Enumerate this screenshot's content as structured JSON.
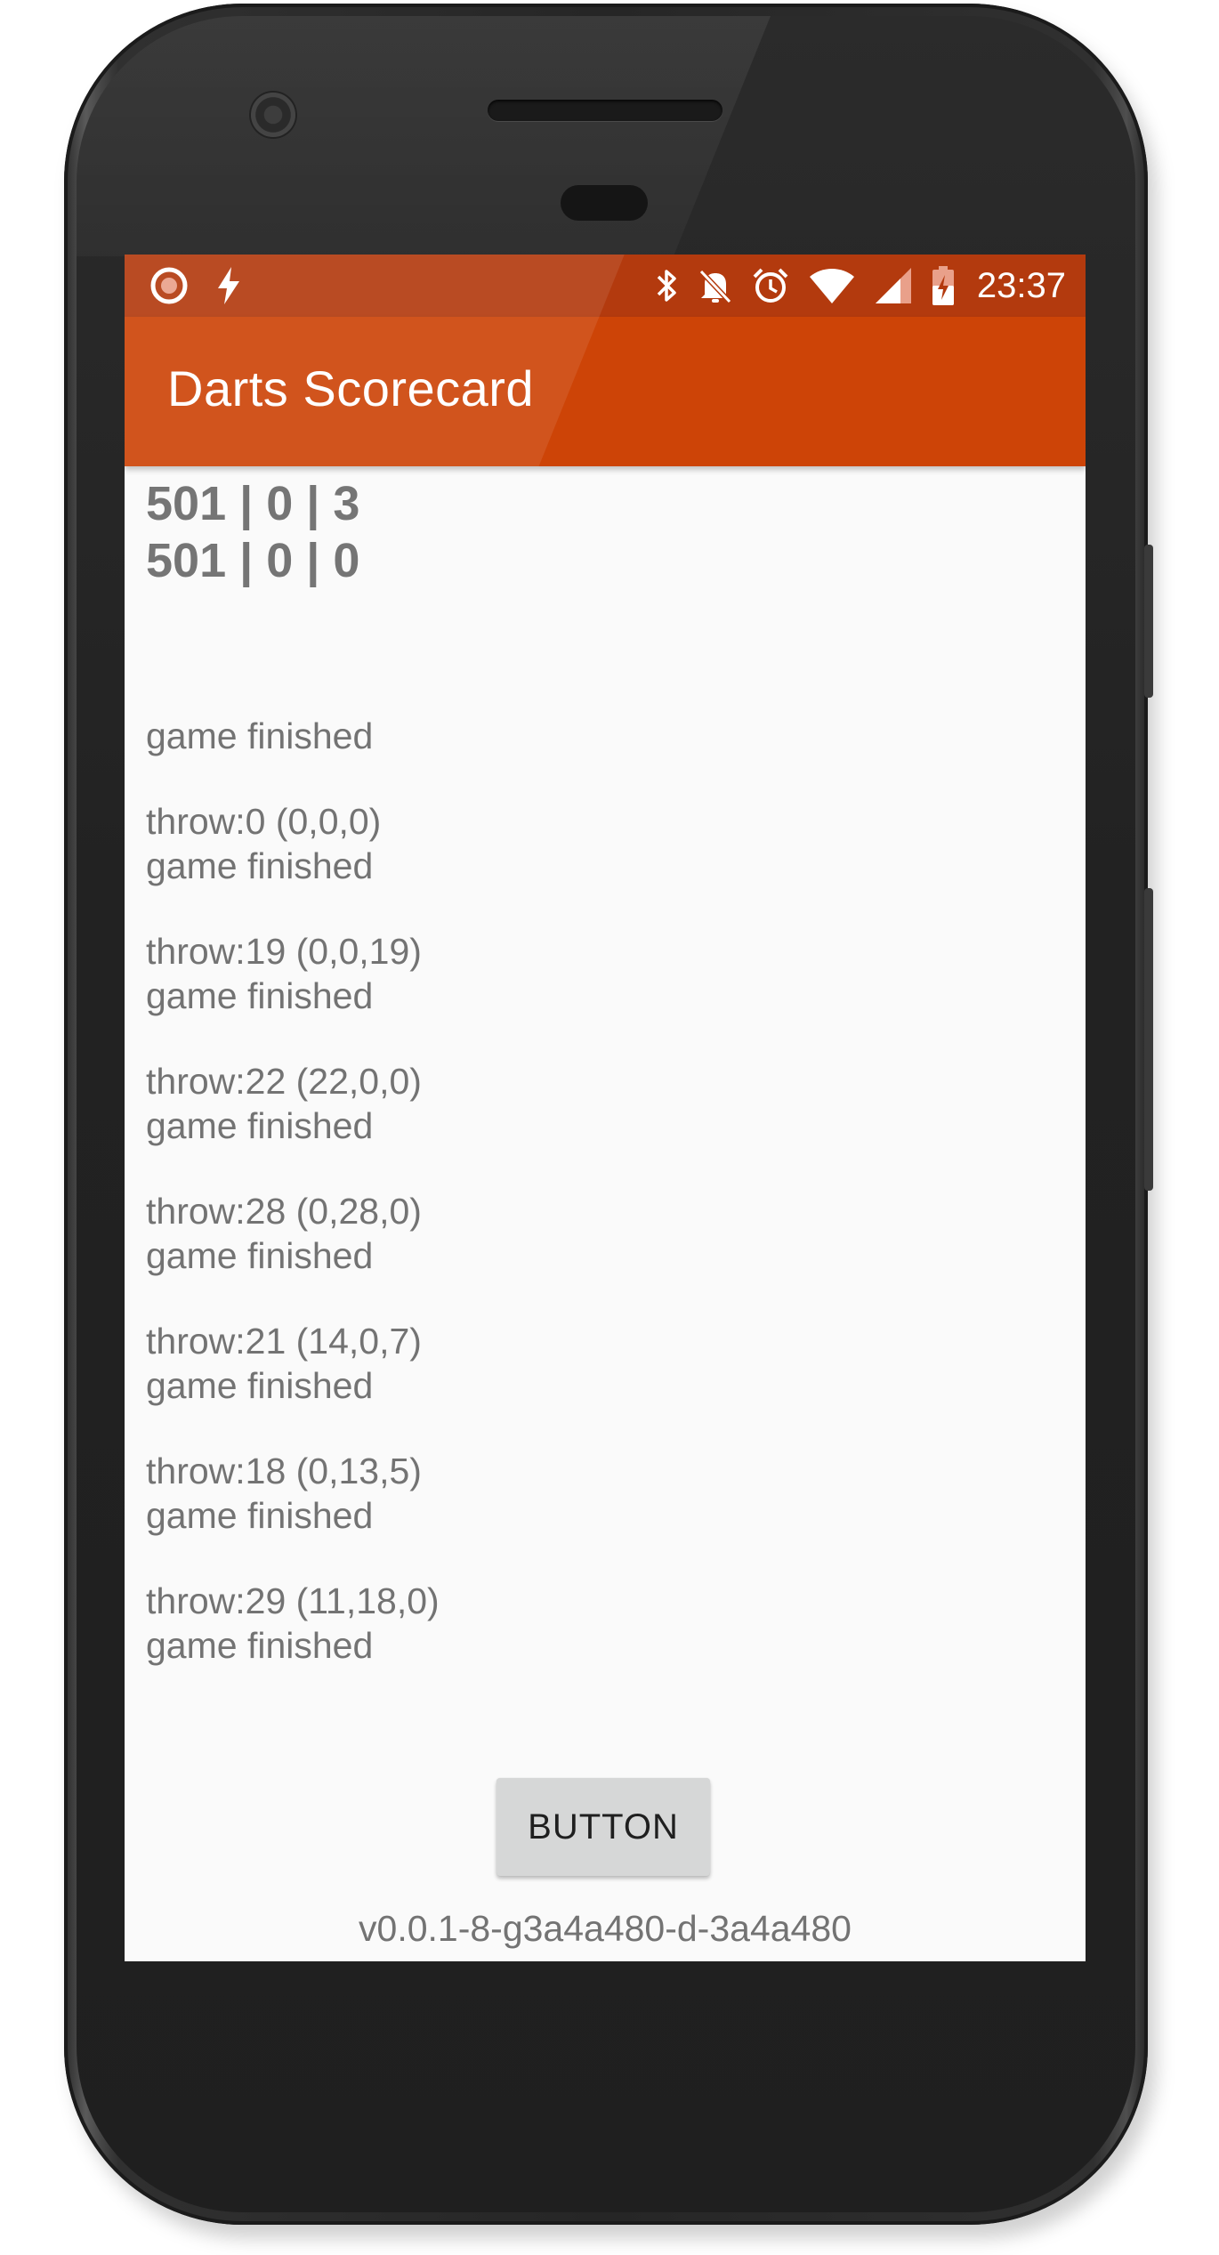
{
  "status_bar": {
    "time": "23:37",
    "left_icons": [
      "record-icon",
      "flash-icon"
    ],
    "right_icons": [
      "bluetooth-icon",
      "notifications-off-icon",
      "alarm-icon",
      "wifi-icon",
      "cell-signal-icon",
      "battery-charging-icon"
    ]
  },
  "app_bar": {
    "title": "Darts Scorecard"
  },
  "scores": [
    {
      "line": "501 | 0 | 3"
    },
    {
      "line": "501 | 0 | 0"
    }
  ],
  "log": [
    {
      "throw": "",
      "status": "game finished"
    },
    {
      "throw": "throw:0 (0,0,0)",
      "status": "game finished"
    },
    {
      "throw": "throw:19 (0,0,19)",
      "status": "game finished"
    },
    {
      "throw": "throw:22 (22,0,0)",
      "status": "game finished"
    },
    {
      "throw": "throw:28 (0,28,0)",
      "status": "game finished"
    },
    {
      "throw": "throw:21 (14,0,7)",
      "status": "game finished"
    },
    {
      "throw": "throw:18 (0,13,5)",
      "status": "game finished"
    },
    {
      "throw": "throw:29 (11,18,0)",
      "status": "game finished"
    }
  ],
  "button": {
    "label": "BUTTON"
  },
  "version": "v0.0.1-8-g3a4a480-d-3a4a480",
  "colors": {
    "status_bar": "#b33a0e",
    "app_bar": "#cd4407",
    "background": "#fafafa",
    "text": "#737373"
  }
}
